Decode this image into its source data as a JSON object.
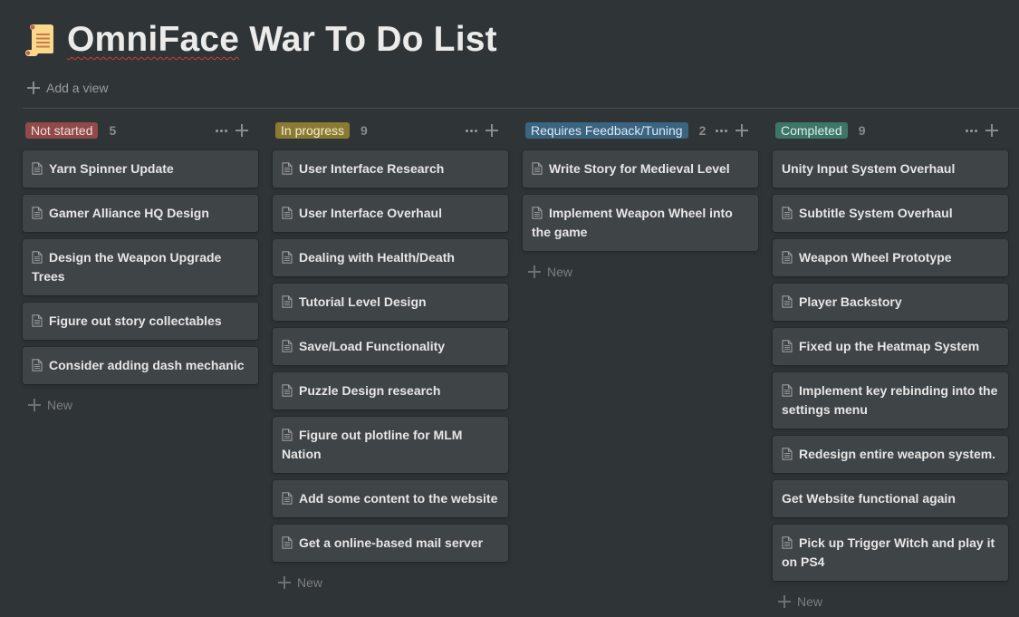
{
  "page": {
    "title_icon": "scroll-icon",
    "title_misspelled_word": "OmniFace",
    "title_rest": " War To Do List",
    "add_view_label": "Add a view"
  },
  "board": {
    "new_label": "New",
    "columns": [
      {
        "status": "Not started",
        "count": "5",
        "tag_bg": "#8f4a49",
        "tag_fg": "#f3dcdb",
        "cards": [
          {
            "title": "Yarn Spinner Update",
            "icon": "page-icon"
          },
          {
            "title": "Gamer Alliance HQ Design",
            "icon": "page-icon"
          },
          {
            "title": "Design the Weapon Upgrade Trees",
            "icon": "page-icon"
          },
          {
            "title": "Figure out story collectables",
            "icon": "page-icon"
          },
          {
            "title": "Consider adding dash mechanic",
            "icon": "page-icon"
          }
        ]
      },
      {
        "status": "In progress",
        "count": "9",
        "tag_bg": "#8a7b34",
        "tag_fg": "#f4edc9",
        "cards": [
          {
            "title": "User Interface Research",
            "icon": "page-icon"
          },
          {
            "title": "User Interface Overhaul",
            "icon": "page-icon"
          },
          {
            "title": "Dealing with Health/Death",
            "icon": "page-icon"
          },
          {
            "title": "Tutorial Level Design",
            "icon": "page-icon"
          },
          {
            "title": "Save/Load Functionality",
            "icon": "page-icon"
          },
          {
            "title": "Puzzle Design research",
            "icon": "page-icon"
          },
          {
            "title": "Figure out plotline for MLM Nation",
            "icon": "page-icon"
          },
          {
            "title": "Add some content to the website",
            "icon": "page-icon"
          },
          {
            "title": "Get a online-based mail server",
            "icon": "page-icon"
          }
        ]
      },
      {
        "status": "Requires Feedback/Tuning",
        "count": "2",
        "tag_bg": "#3b6480",
        "tag_fg": "#dbe9f3",
        "cards": [
          {
            "title": "Write Story for Medieval Level",
            "icon": "page-icon"
          },
          {
            "title": "Implement Weapon Wheel into the game",
            "icon": "page-icon"
          }
        ]
      },
      {
        "status": "Completed",
        "count": "9",
        "tag_bg": "#3d7566",
        "tag_fg": "#d9efe8",
        "cards": [
          {
            "title": "Unity Input System Overhaul",
            "icon": ""
          },
          {
            "title": "Subtitle System Overhaul",
            "icon": "page-icon"
          },
          {
            "title": "Weapon Wheel Prototype",
            "icon": "page-icon"
          },
          {
            "title": "Player Backstory",
            "icon": "page-icon"
          },
          {
            "title": "Fixed up the Heatmap System",
            "icon": "page-icon"
          },
          {
            "title": "Implement key rebinding into the settings menu",
            "icon": "page-icon"
          },
          {
            "title": "Redesign entire weapon system.",
            "icon": "page-icon"
          },
          {
            "title": "Get Website functional again",
            "icon": ""
          },
          {
            "title": "Pick up Trigger Witch and play it on PS4",
            "icon": "page-icon"
          }
        ]
      }
    ]
  }
}
